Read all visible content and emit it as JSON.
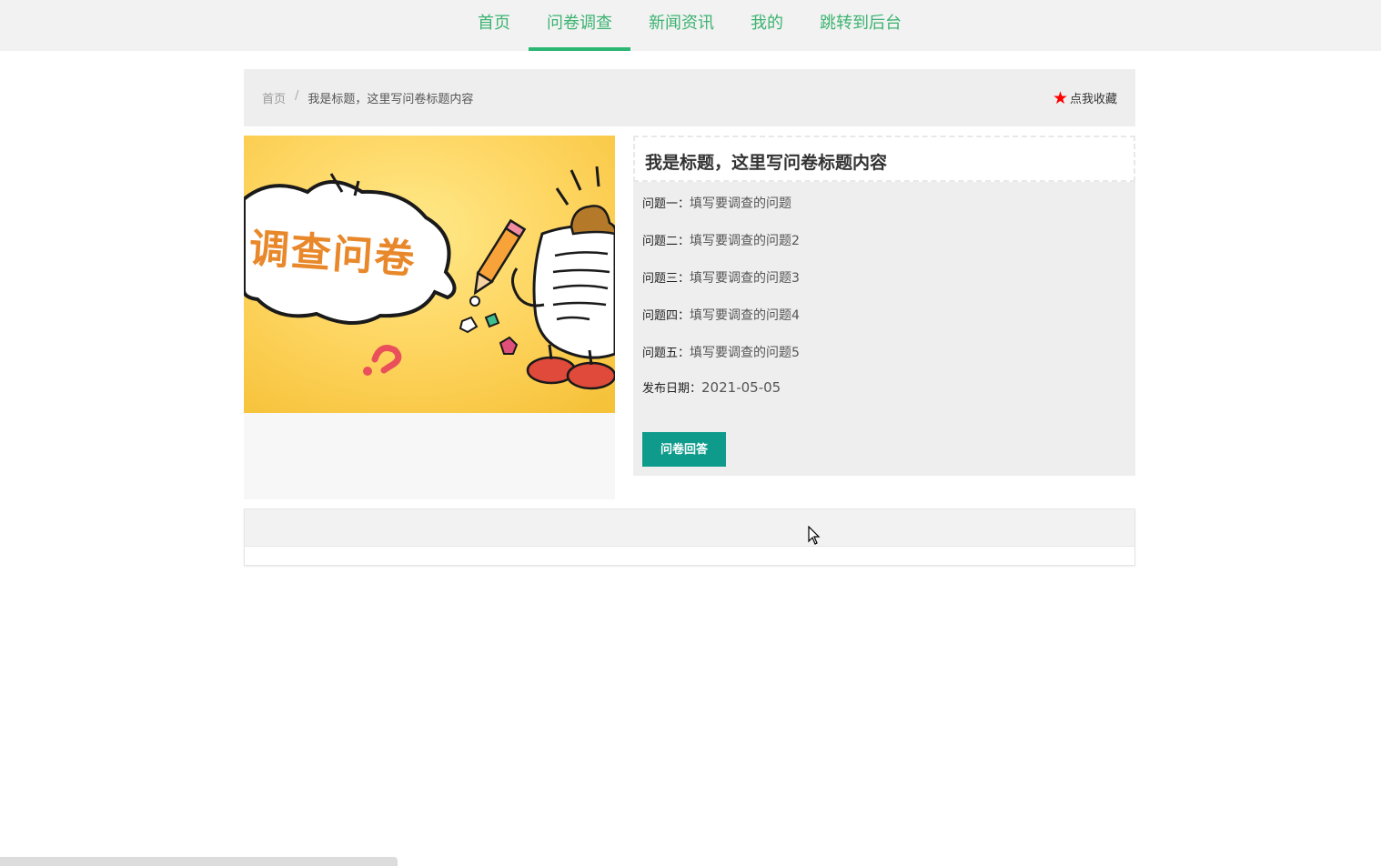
{
  "nav": {
    "items": [
      {
        "label": "首页",
        "active": false
      },
      {
        "label": "问卷调查",
        "active": true
      },
      {
        "label": "新闻资讯",
        "active": false
      },
      {
        "label": "我的",
        "active": false
      },
      {
        "label": "跳转到后台",
        "active": false
      }
    ],
    "accent_color": "#2bb673"
  },
  "breadcrumb": {
    "home": "首页",
    "separator": "/",
    "current": "我是标题，这里写问卷标题内容"
  },
  "favorite": {
    "icon": "star-icon",
    "label": "点我收藏",
    "icon_color": "#ff0000"
  },
  "banner": {
    "text": "调查问卷"
  },
  "survey": {
    "title": "我是标题，这里写问卷标题内容",
    "questions": [
      {
        "label": "问题一：",
        "text": "填写要调查的问题"
      },
      {
        "label": "问题二：",
        "text": "填写要调查的问题2"
      },
      {
        "label": "问题三：",
        "text": "填写要调查的问题3"
      },
      {
        "label": "问题四：",
        "text": "填写要调查的问题4"
      },
      {
        "label": "问题五：",
        "text": "填写要调查的问题5"
      }
    ],
    "date_label": "发布日期：",
    "date_value": "2021-05-05",
    "answer_button": "问卷回答",
    "button_color": "#0e9b8b"
  }
}
